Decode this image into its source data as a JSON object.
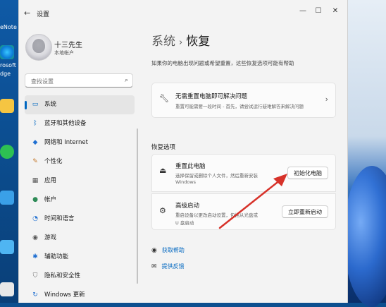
{
  "desktop": {
    "labels": [
      "eNote",
      "rosoft",
      "dge",
      "",
      "",
      "",
      "",
      "",
      ""
    ]
  },
  "window": {
    "title": "设置",
    "controls": {
      "minimize": "—",
      "maximize": "☐",
      "close": "✕"
    }
  },
  "user": {
    "name": "十三先生",
    "account_type": "本地帐户"
  },
  "search": {
    "placeholder": "查找设置"
  },
  "sidebar": {
    "items": [
      {
        "label": "系统",
        "icon": "monitor-icon",
        "active": true
      },
      {
        "label": "蓝牙和其他设备",
        "icon": "bluetooth-icon"
      },
      {
        "label": "网络和 Internet",
        "icon": "wifi-icon"
      },
      {
        "label": "个性化",
        "icon": "brush-icon"
      },
      {
        "label": "应用",
        "icon": "apps-icon"
      },
      {
        "label": "帐户",
        "icon": "person-icon"
      },
      {
        "label": "时间和语言",
        "icon": "globe-clock-icon"
      },
      {
        "label": "游戏",
        "icon": "gamepad-icon"
      },
      {
        "label": "辅助功能",
        "icon": "accessibility-icon"
      },
      {
        "label": "隐私和安全性",
        "icon": "shield-icon"
      },
      {
        "label": "Windows 更新",
        "icon": "update-icon"
      }
    ]
  },
  "breadcrumb": {
    "parent": "系统",
    "separator": "›",
    "current": "恢复"
  },
  "description": "如果你的电脑出现问题或希望重置，这些恢复选项可能有帮助",
  "fix_card": {
    "title": "无需重置电脑即可解决问题",
    "subtitle": "重置可能需要一段时间 - 首先，请尝试运行疑难解答来解决问题"
  },
  "recovery_options_label": "恢复选项",
  "reset_card": {
    "title": "重置此电脑",
    "subtitle_line1": "选择保留或删除个人文件，然后重新安装",
    "subtitle_line2": "Windows",
    "button": "初始化电脑"
  },
  "advanced_card": {
    "title": "高级启动",
    "subtitle_line1": "重启设备以更改启动设置，包括从光盘或",
    "subtitle_line2": "U 盘启动",
    "button": "立即重新启动"
  },
  "links": {
    "help": "获取帮助",
    "feedback": "提供反馈"
  },
  "colors": {
    "accent": "#0067c0",
    "annotation_arrow": "#d7322a"
  }
}
